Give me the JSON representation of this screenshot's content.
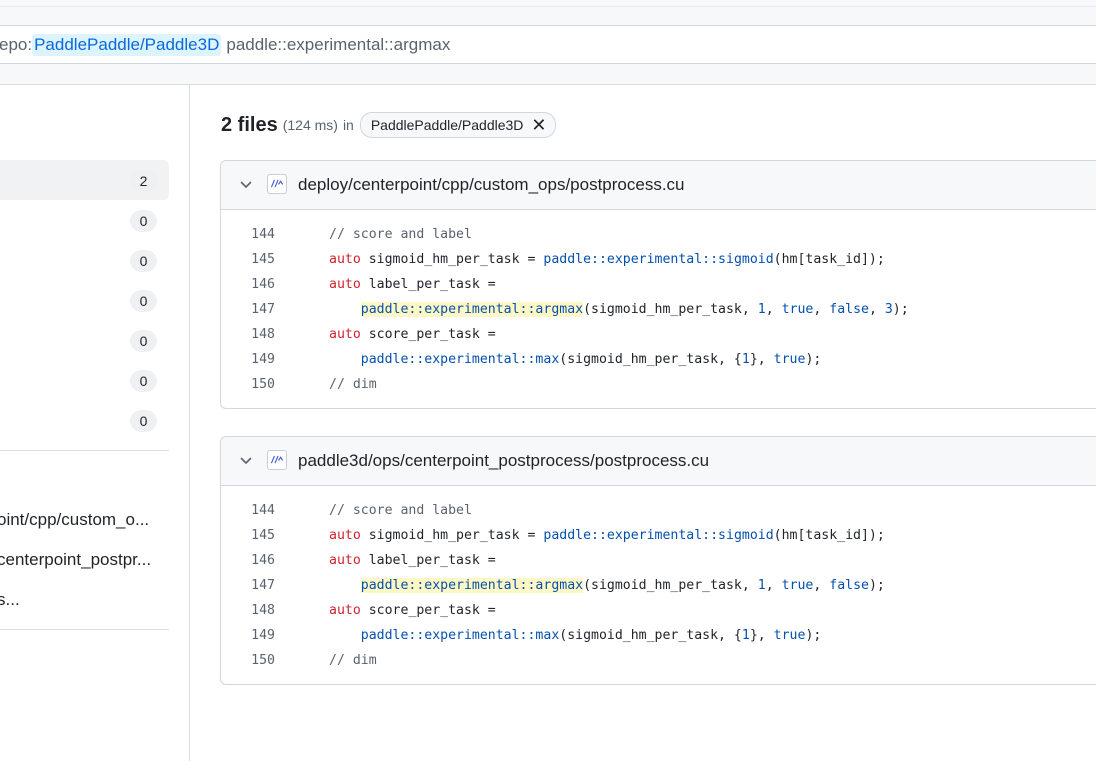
{
  "search": {
    "query_prefix": "epo:",
    "query_repo": "PaddlePaddle/Paddle3D",
    "query_term": "paddle::experimental::argmax"
  },
  "sidebar": {
    "filter_counts": [
      "2",
      "0",
      "0",
      "0",
      "0",
      "0",
      "0"
    ],
    "paths": [
      "oint/cpp/custom_o...",
      "centerpoint_postpr...",
      "s..."
    ]
  },
  "results": {
    "count_label": "2 files",
    "timing": "(124 ms)",
    "in_label": "in",
    "repo_chip": "PaddlePaddle/Paddle3D",
    "files": [
      {
        "path": "deploy/centerpoint/cpp/custom_ops/postprocess.cu",
        "lines": [
          {
            "num": "144",
            "indent": "",
            "tokens": [
              {
                "t": "// score and label",
                "c": "cm"
              }
            ]
          },
          {
            "num": "145",
            "indent": "",
            "tokens": [
              {
                "t": "auto",
                "c": "kw"
              },
              {
                "t": " sigmoid_hm_per_task = "
              },
              {
                "t": "paddle::experimental::sigmoid",
                "c": "fn"
              },
              {
                "t": "(hm[task_id]);"
              }
            ]
          },
          {
            "num": "146",
            "indent": "",
            "tokens": [
              {
                "t": "auto",
                "c": "kw"
              },
              {
                "t": " label_per_task ="
              }
            ]
          },
          {
            "num": "147",
            "indent": "    ",
            "tokens": [
              {
                "t": "paddle::experimental::argmax",
                "c": "fn hl"
              },
              {
                "t": "(sigmoid_hm_per_task, "
              },
              {
                "t": "1",
                "c": "num"
              },
              {
                "t": ", "
              },
              {
                "t": "true",
                "c": "fn"
              },
              {
                "t": ", "
              },
              {
                "t": "false",
                "c": "fn"
              },
              {
                "t": ", "
              },
              {
                "t": "3",
                "c": "num"
              },
              {
                "t": ");"
              }
            ]
          },
          {
            "num": "148",
            "indent": "",
            "tokens": [
              {
                "t": "auto",
                "c": "kw"
              },
              {
                "t": " score_per_task ="
              }
            ]
          },
          {
            "num": "149",
            "indent": "    ",
            "tokens": [
              {
                "t": "paddle::experimental::max",
                "c": "fn"
              },
              {
                "t": "(sigmoid_hm_per_task, {"
              },
              {
                "t": "1",
                "c": "num"
              },
              {
                "t": "}, "
              },
              {
                "t": "true",
                "c": "fn"
              },
              {
                "t": ");"
              }
            ]
          },
          {
            "num": "150",
            "indent": "",
            "tokens": [
              {
                "t": "// dim",
                "c": "cm"
              }
            ]
          }
        ]
      },
      {
        "path": "paddle3d/ops/centerpoint_postprocess/postprocess.cu",
        "lines": [
          {
            "num": "144",
            "indent": "",
            "tokens": [
              {
                "t": "// score and label",
                "c": "cm"
              }
            ]
          },
          {
            "num": "145",
            "indent": "",
            "tokens": [
              {
                "t": "auto",
                "c": "kw"
              },
              {
                "t": " sigmoid_hm_per_task = "
              },
              {
                "t": "paddle::experimental::sigmoid",
                "c": "fn"
              },
              {
                "t": "(hm[task_id]);"
              }
            ]
          },
          {
            "num": "146",
            "indent": "",
            "tokens": [
              {
                "t": "auto",
                "c": "kw"
              },
              {
                "t": " label_per_task ="
              }
            ]
          },
          {
            "num": "147",
            "indent": "    ",
            "tokens": [
              {
                "t": "paddle::experimental::argmax",
                "c": "fn hl"
              },
              {
                "t": "(sigmoid_hm_per_task, "
              },
              {
                "t": "1",
                "c": "num"
              },
              {
                "t": ", "
              },
              {
                "t": "true",
                "c": "fn"
              },
              {
                "t": ", "
              },
              {
                "t": "false",
                "c": "fn"
              },
              {
                "t": ");"
              }
            ]
          },
          {
            "num": "148",
            "indent": "",
            "tokens": [
              {
                "t": "auto",
                "c": "kw"
              },
              {
                "t": " score_per_task ="
              }
            ]
          },
          {
            "num": "149",
            "indent": "    ",
            "tokens": [
              {
                "t": "paddle::experimental::max",
                "c": "fn"
              },
              {
                "t": "(sigmoid_hm_per_task, {"
              },
              {
                "t": "1",
                "c": "num"
              },
              {
                "t": "}, "
              },
              {
                "t": "true",
                "c": "fn"
              },
              {
                "t": ");"
              }
            ]
          },
          {
            "num": "150",
            "indent": "",
            "tokens": [
              {
                "t": "// dim",
                "c": "cm"
              }
            ]
          }
        ]
      }
    ]
  },
  "colors": {
    "link": "#0969da",
    "keyword": "#cf222e",
    "entity": "#0550ae",
    "comment": "#59636e",
    "highlight": "#fff8c5",
    "border": "#d0d7de"
  },
  "icons": {
    "chevron": "chevron-down-icon",
    "file": "code-file-icon",
    "remove": "x-icon"
  }
}
